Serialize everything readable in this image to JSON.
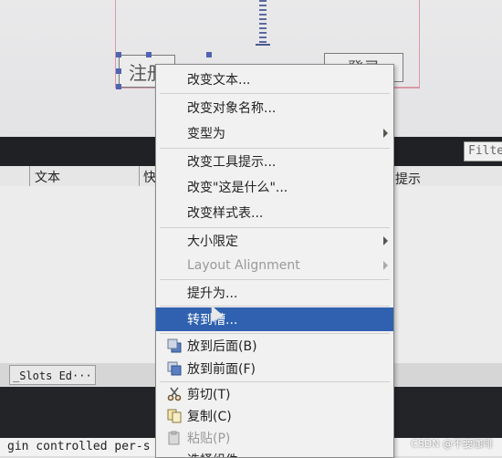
{
  "form": {
    "register_label": "注册",
    "login_label": "登录"
  },
  "filter": {
    "placeholder": "Filte"
  },
  "action_table": {
    "headers": [
      "文本",
      "快",
      "提示"
    ]
  },
  "tabs": {
    "slots_label": "_Slots Ed···"
  },
  "console": {
    "text": "gin controlled per-s"
  },
  "context_menu": {
    "items": [
      {
        "label": "改变文本...",
        "enabled": true
      },
      {
        "label": "改变对象名称...",
        "enabled": true
      },
      {
        "label": "变型为",
        "enabled": true,
        "submenu": true
      },
      {
        "label": "改变工具提示...",
        "enabled": true
      },
      {
        "label": "改变\"这是什么\"...",
        "enabled": true
      },
      {
        "label": "改变样式表...",
        "enabled": true
      },
      {
        "label": "大小限定",
        "enabled": true,
        "submenu": true
      },
      {
        "label": "Layout Alignment",
        "enabled": false,
        "submenu": true
      },
      {
        "label": "提升为...",
        "enabled": true
      },
      {
        "label": "转到槽...",
        "enabled": true,
        "highlighted": true
      },
      {
        "label": "放到后面(B)",
        "enabled": true,
        "icon": "send-to-back-icon"
      },
      {
        "label": "放到前面(F)",
        "enabled": true,
        "icon": "bring-to-front-icon"
      },
      {
        "label": "剪切(T)",
        "enabled": true,
        "icon": "scissors-icon"
      },
      {
        "label": "复制(C)",
        "enabled": true,
        "icon": "copy-icon"
      },
      {
        "label": "粘贴(P)",
        "enabled": false,
        "icon": "paste-icon"
      },
      {
        "label": "选择组件",
        "enabled": true
      }
    ]
  },
  "colors": {
    "highlight": "#2f61b0",
    "form_border": "#d79aa5",
    "selection_handle": "#4f63b3"
  },
  "watermark": "CSDN @不要咖啡"
}
